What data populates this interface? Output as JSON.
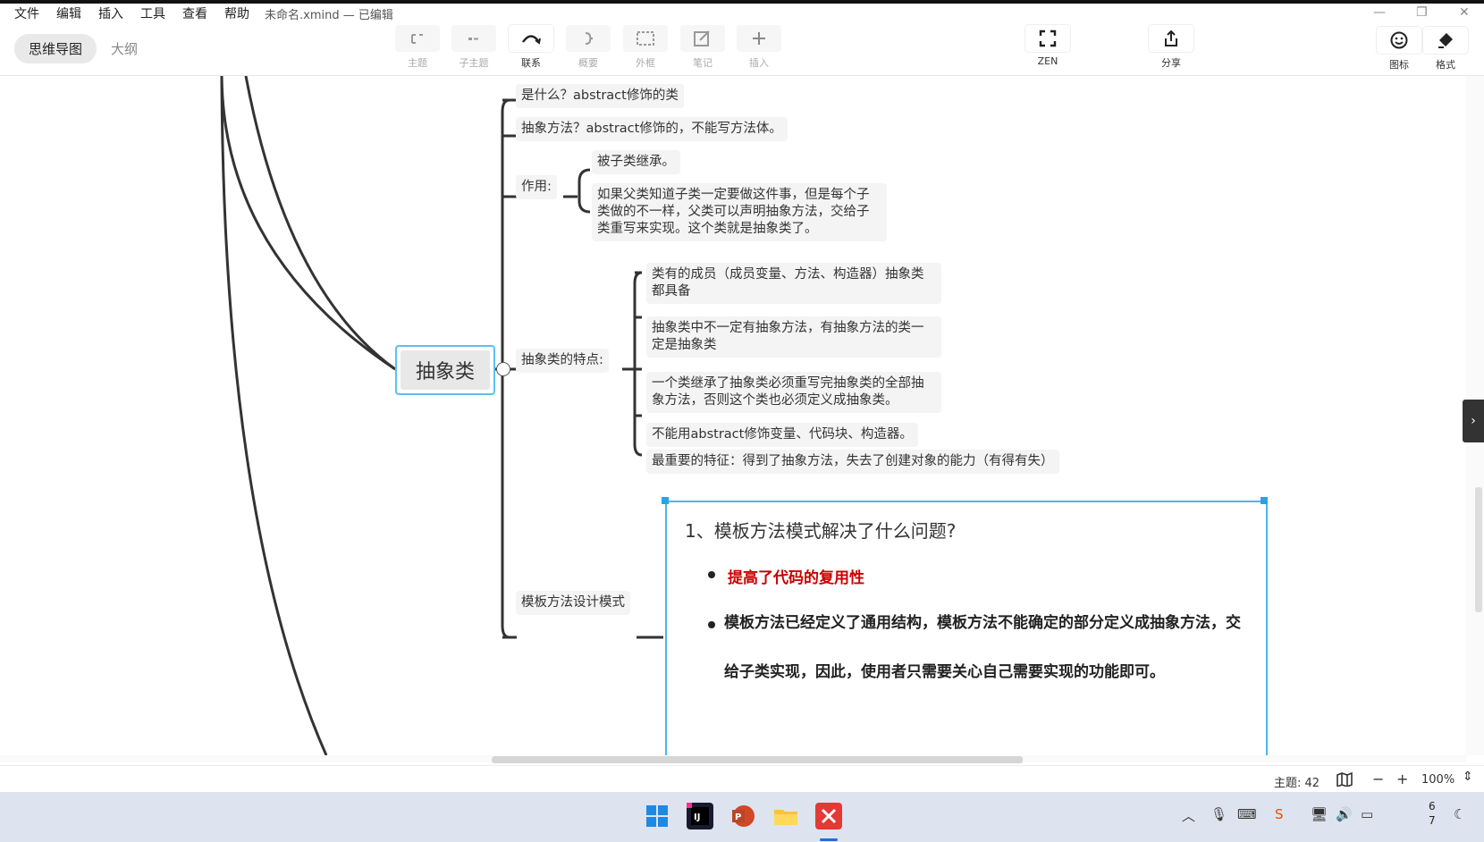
{
  "menu": {
    "items": [
      "文件",
      "编辑",
      "插入",
      "工具",
      "查看",
      "帮助"
    ],
    "file_title": "未命名.xmind — 已编辑"
  },
  "window": {
    "minimize": "—",
    "maximize": "❐",
    "close": "✕"
  },
  "view_tabs": {
    "mindmap": "思维导图",
    "outline": "大纲"
  },
  "toolbar": {
    "topic": "主题",
    "subtopic": "子主题",
    "relationship": "联系",
    "summary": "概要",
    "boundary": "外框",
    "note": "笔记",
    "insert": "插入",
    "zen": "ZEN",
    "share": "分享",
    "icon": "图标",
    "format": "格式"
  },
  "mindmap": {
    "central": "抽象类",
    "branches": {
      "what": "是什么？abstract修饰的类",
      "abstract_method": "抽象方法？abstract修饰的，不能写方法体。",
      "purpose": "作用:",
      "purpose_children": [
        "被子类继承。",
        "如果父类知道子类一定要做这件事，但是每个子类做的不一样，父类可以声明抽象方法，交给子类重写来实现。这个类就是抽象类了。"
      ],
      "features": "抽象类的特点:",
      "features_children": [
        "类有的成员（成员变量、方法、构造器）抽象类都具备",
        "抽象类中不一定有抽象方法，有抽象方法的类一定是抽象类",
        "一个类继承了抽象类必须重写完抽象类的全部抽象方法，否则这个类也必须定义成抽象类。",
        "不能用abstract修饰变量、代码块、构造器。",
        "最重要的特征：得到了抽象方法，失去了创建对象的能力（有得有失）"
      ],
      "template": "模板方法设计模式"
    },
    "note": {
      "heading": "1、模板方法模式解决了什么问题?",
      "bullet1": "提高了代码的复用性",
      "bullet2": "模板方法已经定义了通用结构，模板方法不能确定的部分定义成抽象方法，交给子类实现，因此，使用者只需要关心自己需要实现的功能即可。"
    }
  },
  "status": {
    "topic_count": "主题: 42",
    "zoom": "100%"
  },
  "taskbar": {
    "apps": [
      "windows-start",
      "intellij-idea",
      "powerpoint",
      "file-explorer",
      "xmind"
    ],
    "clock_line1": "6",
    "clock_line2": "7"
  },
  "colors": {
    "accent_blue": "#49b7ee",
    "note_red": "#cc0000",
    "xmind_red": "#e53935"
  }
}
